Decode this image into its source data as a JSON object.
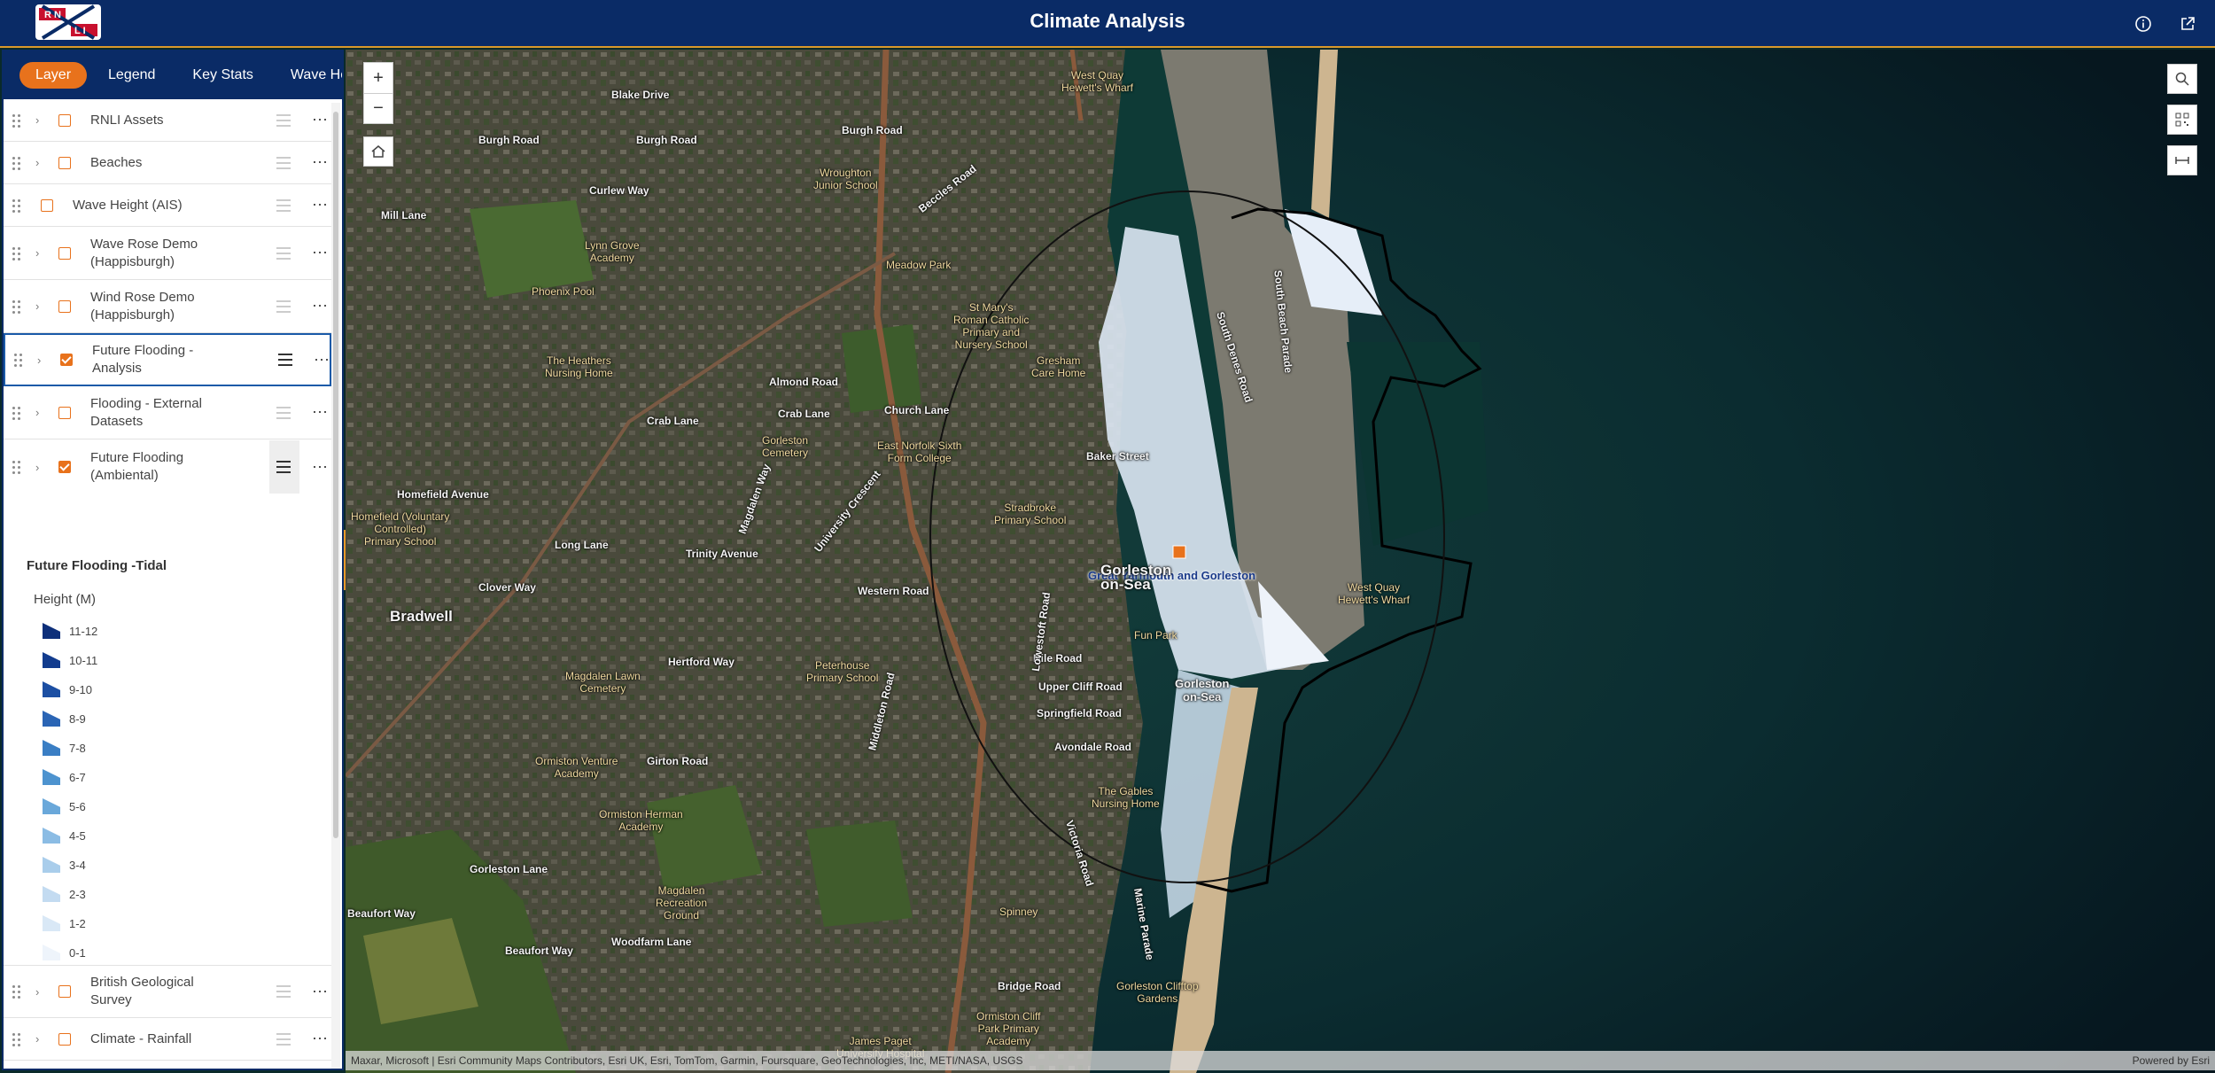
{
  "header": {
    "title": "Climate Analysis",
    "logo_text": "RNLI",
    "info_icon": "info-icon",
    "share_icon": "share-icon"
  },
  "panel": {
    "tabs": [
      {
        "label": "Layer",
        "active": true
      },
      {
        "label": "Legend",
        "active": false
      },
      {
        "label": "Key Stats",
        "active": false
      },
      {
        "label": "Wave Hei",
        "active": false
      }
    ],
    "layers": [
      {
        "label": "RNLI Assets",
        "checked": false,
        "expandable": true
      },
      {
        "label": "Beaches",
        "checked": false,
        "expandable": true
      },
      {
        "label": "Wave Height (AIS)",
        "checked": false,
        "expandable": false
      },
      {
        "label": "Wave Rose Demo\n(Happisburgh)",
        "checked": false,
        "expandable": true
      },
      {
        "label": "Wind Rose Demo\n(Happisburgh)",
        "checked": false,
        "expandable": true
      },
      {
        "label": "Future Flooding -\nAnalysis",
        "checked": true,
        "expandable": true,
        "selected": true
      },
      {
        "label": "Flooding - External\nDatasets",
        "checked": false,
        "expandable": true
      },
      {
        "label": "Future Flooding\n(Ambiental)",
        "checked": true,
        "expandable": true
      }
    ],
    "legend": {
      "title": "Future Flooding -Tidal",
      "subtitle": "Height (M)",
      "items": [
        {
          "label": "11-12",
          "color": "#0d2f7a"
        },
        {
          "label": "10-11",
          "color": "#123c8e"
        },
        {
          "label": "9-10",
          "color": "#1c4fa3"
        },
        {
          "label": "8-9",
          "color": "#2a65b5"
        },
        {
          "label": "7-8",
          "color": "#3a7ec4"
        },
        {
          "label": "6-7",
          "color": "#4d93cf"
        },
        {
          "label": "5-6",
          "color": "#6aa8da"
        },
        {
          "label": "4-5",
          "color": "#8bbce4"
        },
        {
          "label": "3-4",
          "color": "#a9cdeb"
        },
        {
          "label": "2-3",
          "color": "#c3dbf1"
        },
        {
          "label": "1-2",
          "color": "#d9e8f6"
        },
        {
          "label": "0-1",
          "color": "#eef4fb"
        }
      ]
    },
    "bottom_layers": [
      {
        "label": "British Geological\nSurvey",
        "checked": false
      },
      {
        "label": "Climate - Rainfall",
        "checked": false
      }
    ]
  },
  "map": {
    "labels": {
      "blake_drive": "Blake Drive",
      "burgh_road_1": "Burgh Road",
      "burgh_road_2": "Burgh Road",
      "burgh_road_3": "Burgh Road",
      "curlew_way": "Curlew Way",
      "mill_lane": "Mill Lane",
      "lynn_grove_academy": "Lynn Grove\nAcademy",
      "phoenix_pool": "Phoenix Pool",
      "the_heathers": "The Heathers\nNursing Home",
      "almond_road": "Almond Road",
      "crab_lane_1": "Crab Lane",
      "crab_lane_2": "Crab Lane",
      "church_lane": "Church Lane",
      "meadow_park": "Meadow Park",
      "wroughton": "Wroughton\nJunior School",
      "st_marys": "St Mary's\nRoman Catholic\nPrimary and\nNursery School",
      "gresham": "Gresham\nCare Home",
      "gorleston_cemetery": "Gorleston\nCemetery",
      "east_norfolk": "East Norfolk Sixth\nForm College",
      "homefield_avenue": "Homefield Avenue",
      "homefield_school": "Homefield (Voluntary\nControlled)\nPrimary School",
      "long_lane": "Long Lane",
      "trinity_avenue": "Trinity Avenue",
      "western_road": "Western Road",
      "stradbroke": "Stradbroke\nPrimary School",
      "baker_street": "Baker Street",
      "great_yarmouth": "Great Yarmouth and Gorleston",
      "gorleston_town": "Gorleston\non-Sea",
      "clover_way": "Clover Way",
      "bradwell": "Bradwell",
      "hertford_way": "Hertford Way",
      "magdalen_lawn": "Magdalen Lawn\nCemetery",
      "peterhouse": "Peterhouse\nPrimary School",
      "nile_road": "Nile Road",
      "upper_cliff": "Upper Cliff Road",
      "springfield": "Springfield Road",
      "avondale": "Avondale Road",
      "fun_park": "Fun Park",
      "gorleston_2": "Gorleston\non-Sea",
      "girton_road": "Girton Road",
      "ormiston_venture": "Ormiston Venture\nAcademy",
      "ormiston_herman": "Ormiston Herman\nAcademy",
      "the_gables": "The Gables\nNursing Home",
      "gorleston_lane": "Gorleston Lane",
      "beaufort_way": "Beaufort Way",
      "beaufort_way_2": "Beaufort Way",
      "woodfarm_lane": "Woodfarm Lane",
      "magdalen_rec": "Magdalen\nRecreation\nGround",
      "spinney": "Spinney",
      "bridge_road": "Bridge Road",
      "gorleston_cliff": "Gorleston Clifftop\nGardens",
      "ormiston_cliff": "Ormiston Cliff\nPark Primary\nAcademy",
      "james_paget": "James Paget\nUniversity Hospital",
      "west_quay_1": "West Quay\nHewett's Wharf",
      "west_quay_2": "West Quay\nHewett's Wharf",
      "beccles_road": "Beccles Road",
      "victoria_road": "Victoria Road",
      "lowestoft_road": "Lowestoft Road",
      "marine_parade": "Marine Parade",
      "south_denes": "South Denes Road",
      "south_beach": "South Beach Parade",
      "university_crescent": "University Crescent",
      "middleton_road": "Middleton Road",
      "magdalen_way": "Magdalen Way"
    },
    "zoom_in": "+",
    "zoom_out": "−",
    "attribution": "Maxar, Microsoft | Esri Community Maps Contributors, Esri UK, Esri, TomTom, Garmin, Foursquare, GeoTechnologies, Inc, METI/NASA, USGS",
    "powered_by": "Powered by Esri"
  }
}
